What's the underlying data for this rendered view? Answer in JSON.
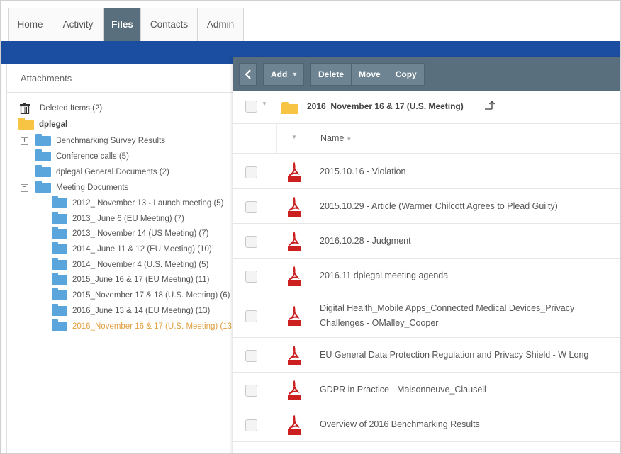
{
  "nav": {
    "tabs": [
      {
        "label": "Home",
        "active": false
      },
      {
        "label": "Activity",
        "active": false
      },
      {
        "label": "Files",
        "active": true
      },
      {
        "label": "Contacts",
        "active": false
      },
      {
        "label": "Admin",
        "active": false
      }
    ]
  },
  "left_panel": {
    "title": "Attachments",
    "tree": [
      {
        "label": "Deleted Items (2)",
        "icon": "trash-icon"
      },
      {
        "label": "dplegal",
        "icon": "folder-icon"
      },
      {
        "label": "Benchmarking Survey Results",
        "icon": "folder-icon",
        "expander": "+"
      },
      {
        "label": "Conference calls (5)",
        "icon": "folder-icon"
      },
      {
        "label": "dplegal General Documents (2)",
        "icon": "folder-icon"
      },
      {
        "label": "Meeting Documents",
        "icon": "folder-icon",
        "expander": "−"
      },
      {
        "label": "2012_ November 13 - Launch meeting (5)",
        "icon": "folder-icon"
      },
      {
        "label": "2013_ June 6 (EU Meeting) (7)",
        "icon": "folder-icon"
      },
      {
        "label": "2013_ November 14 (US Meeting) (7)",
        "icon": "folder-icon"
      },
      {
        "label": "2014_ June 11 & 12 (EU Meeting) (10)",
        "icon": "folder-icon"
      },
      {
        "label": "2014_ November 4 (U.S. Meeting) (5)",
        "icon": "folder-icon"
      },
      {
        "label": "2015_June 16 & 17 (EU Meeting) (11)",
        "icon": "folder-icon"
      },
      {
        "label": "2015_November 17 & 18 (U.S. Meeting) (6)",
        "icon": "folder-icon"
      },
      {
        "label": "2016_June 13 & 14 (EU Meeting) (13)",
        "icon": "folder-icon"
      },
      {
        "label": "2016_November 16 & 17 (U.S. Meeting) (13",
        "icon": "folder-icon",
        "selected": true
      }
    ]
  },
  "toolbar": {
    "add_label": "Add",
    "delete_label": "Delete",
    "move_label": "Move",
    "copy_label": "Copy"
  },
  "current_folder": {
    "title": "2016_November 16 & 17 (U.S. Meeting)"
  },
  "table": {
    "name_header": "Name",
    "files": [
      {
        "name": "2015.10.16 - Violation",
        "icon": "pdf-icon"
      },
      {
        "name": "2015.10.29 - Article (Warmer Chilcott Agrees to Plead Guilty)",
        "icon": "pdf-icon"
      },
      {
        "name": "2016.10.28 - Judgment",
        "icon": "pdf-icon"
      },
      {
        "name": "2016.11 dplegal meeting agenda",
        "icon": "pdf-icon"
      },
      {
        "name": "Digital Health_Mobile Apps_Connected Medical Devices_Privacy Challenges - OMalley_Cooper",
        "icon": "pdf-icon"
      },
      {
        "name": "EU General Data Protection Regulation and Privacy Shield - W Long",
        "icon": "pdf-icon"
      },
      {
        "name": "GDPR in Practice - Maisonneuve_Clausell",
        "icon": "pdf-icon"
      },
      {
        "name": "Overview of 2016 Benchmarking Results",
        "icon": "pdf-icon"
      }
    ]
  },
  "colors": {
    "accent_blue": "#1b4ea0",
    "toolbar": "#5a6f7d",
    "selected_text": "#e0a040",
    "folder_blue": "#5aa6dc",
    "folder_yellow": "#f7c444",
    "pdf_red": "#cc1f1f"
  }
}
